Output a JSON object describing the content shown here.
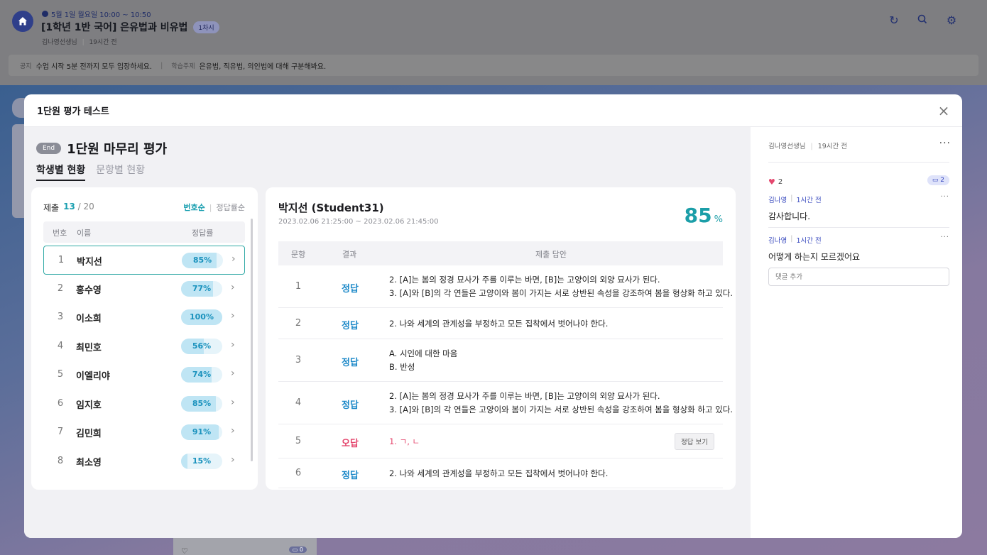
{
  "background": {
    "date": "5월 1일 월요일 10:00 ~ 10:50",
    "class_title": "[1학년 1반 국어] 은유법과 비유법",
    "session_badge": "1차시",
    "teacher": "김나영선생님",
    "time_ago": "19시간 전",
    "notice_label": "공지",
    "notice_text": "수업 시작 5분 전까지 모두 입장하세요.",
    "topic_label": "학습주제",
    "topic_text": "은유법, 직유법, 의인법에 대해 구분해봐요.",
    "bottom_card_count": "0",
    "icons": [
      "home-icon",
      "refresh-icon",
      "search-icon",
      "settings-icon",
      "heart-icon",
      "comment-icon"
    ]
  },
  "modal": {
    "title": "1단원 평가 테스트",
    "status_badge": "End",
    "section_title": "1단원 마무리 평가",
    "tabs": [
      "학생별 현황",
      "문항별 현황"
    ],
    "active_tab": 0
  },
  "students": {
    "submit_label": "제출",
    "submitted": "13",
    "total": "/ 20",
    "sort_number": "번호순",
    "sort_rate": "정답률순",
    "col_no": "번호",
    "col_name": "이름",
    "col_rate": "정답률",
    "rows": [
      {
        "no": "1",
        "name": "박지선",
        "rate": "85%",
        "rate_value": 0.85,
        "selected": true
      },
      {
        "no": "2",
        "name": "홍수영",
        "rate": "77%",
        "rate_value": 0.77
      },
      {
        "no": "3",
        "name": "이소희",
        "rate": "100%",
        "rate_value": 1.0
      },
      {
        "no": "4",
        "name": "최민호",
        "rate": "56%",
        "rate_value": 0.56
      },
      {
        "no": "5",
        "name": "이엘리야",
        "rate": "74%",
        "rate_value": 0.74
      },
      {
        "no": "6",
        "name": "임지호",
        "rate": "85%",
        "rate_value": 0.85
      },
      {
        "no": "7",
        "name": "김민희",
        "rate": "91%",
        "rate_value": 0.91
      },
      {
        "no": "8",
        "name": "최소영",
        "rate": "15%",
        "rate_value": 0.15
      }
    ]
  },
  "detail": {
    "student": "박지선 (Student31)",
    "time_range": "2023.02.06 21:25:00 ~ 2023.02.06 21:45:00",
    "score": "85",
    "score_unit": "%",
    "col_question": "문항",
    "col_result": "결과",
    "col_answer": "제출 답안",
    "view_answer_label": "정답 보기",
    "answers": [
      {
        "q": "1",
        "result": "정답",
        "correct": true,
        "lines": [
          "2. [A]는 봄의 정경 묘사가 주를 이루는 바면, [B]는 고양이의 외양 묘사가 된다.",
          "3. [A]와 [B]의 각 연들은 고양이와 봄이 가지는 서로 상반된 속성을 강조하여 봄을 형상화 하고 있다."
        ]
      },
      {
        "q": "2",
        "result": "정답",
        "correct": true,
        "lines": [
          "2. 나와 세계의 관계성을 부정하고 모든 집착에서 벗어나야 한다."
        ]
      },
      {
        "q": "3",
        "result": "정답",
        "correct": true,
        "lines": [
          "A. 시인에 대한 마음",
          "B. 반성"
        ]
      },
      {
        "q": "4",
        "result": "정답",
        "correct": true,
        "lines": [
          "2. [A]는 봄의 정경 묘사가 주를 이루는 바면, [B]는 고양이의 외양 묘사가 된다.",
          "3. [A]와 [B]의 각 연들은 고양이와 봄이 가지는 서로 상반된 속성을 강조하여 봄을 형상화 하고 있다."
        ]
      },
      {
        "q": "5",
        "result": "오답",
        "correct": false,
        "lines": [
          "1. ㄱ, ㄴ"
        ]
      },
      {
        "q": "6",
        "result": "정답",
        "correct": true,
        "lines": [
          "2. 나와 세계의 관계성을 부정하고 모든 집착에서 벗어나야 한다."
        ]
      }
    ]
  },
  "comments": {
    "author": "김나영선생님",
    "time": "19시간 전",
    "likes": "2",
    "count": "2",
    "replies": [
      {
        "author": "김나영",
        "time": "1시간 전",
        "text": "감사합니다."
      },
      {
        "author": "김나영",
        "time": "1시간 전",
        "text": "어떻게 하는지 모르겠어요"
      }
    ],
    "input_placeholder": "댓글 추가"
  }
}
